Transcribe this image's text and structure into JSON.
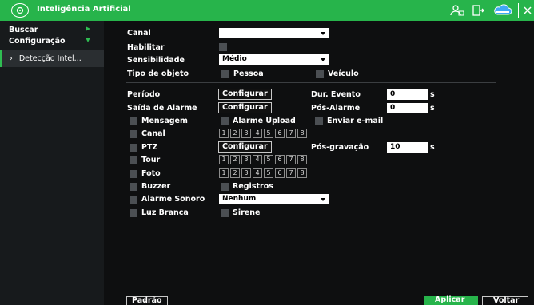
{
  "header": {
    "title": "Inteligência Artificial"
  },
  "sidebar": {
    "items": [
      {
        "label": "Buscar"
      },
      {
        "label": "Configuração"
      },
      {
        "label": "Detecção Intel..."
      }
    ]
  },
  "form": {
    "canal_label": "Canal",
    "canal_value": "",
    "habilitar_label": "Habilitar",
    "sensibilidade_label": "Sensibilidade",
    "sensibilidade_value": "Médio",
    "tipo_label": "Tipo de objeto",
    "pessoa_label": "Pessoa",
    "veiculo_label": "Veículo",
    "periodo_label": "Período",
    "configurar_label": "Configurar",
    "dur_evento_label": "Dur. Evento",
    "dur_evento_value": "0",
    "saida_label": "Saída de Alarme",
    "pos_alarme_label": "Pós-Alarme",
    "pos_alarme_value": "0",
    "seconds_unit": "s",
    "mensagem_label": "Mensagem",
    "alarme_upload_label": "Alarme Upload",
    "enviar_email_label": "Enviar e-mail",
    "canal2_label": "Canal",
    "channels": [
      "1",
      "2",
      "3",
      "4",
      "5",
      "6",
      "7",
      "8"
    ],
    "ptz_label": "PTZ",
    "pos_gravacao_label": "Pós-gravação",
    "pos_gravacao_value": "10",
    "tour_label": "Tour",
    "foto_label": "Foto",
    "buzzer_label": "Buzzer",
    "registros_label": "Registros",
    "alarme_sonoro_label": "Alarme Sonoro",
    "alarme_sonoro_value": "Nenhum",
    "luz_branca_label": "Luz Branca",
    "sirene_label": "Sirene"
  },
  "footer": {
    "padrao_label": "Padrão",
    "aplicar_label": "Aplicar",
    "voltar_label": "Voltar"
  },
  "colors": {
    "accent": "#27b44b",
    "sidebar": "#171a1c",
    "checkbox": "#4b4f53"
  },
  "icons": [
    "ai-logo-icon",
    "user-icon",
    "logout-icon",
    "cloud-icon",
    "close-icon",
    "chevron-right-icon",
    "chevron-down-icon"
  ]
}
